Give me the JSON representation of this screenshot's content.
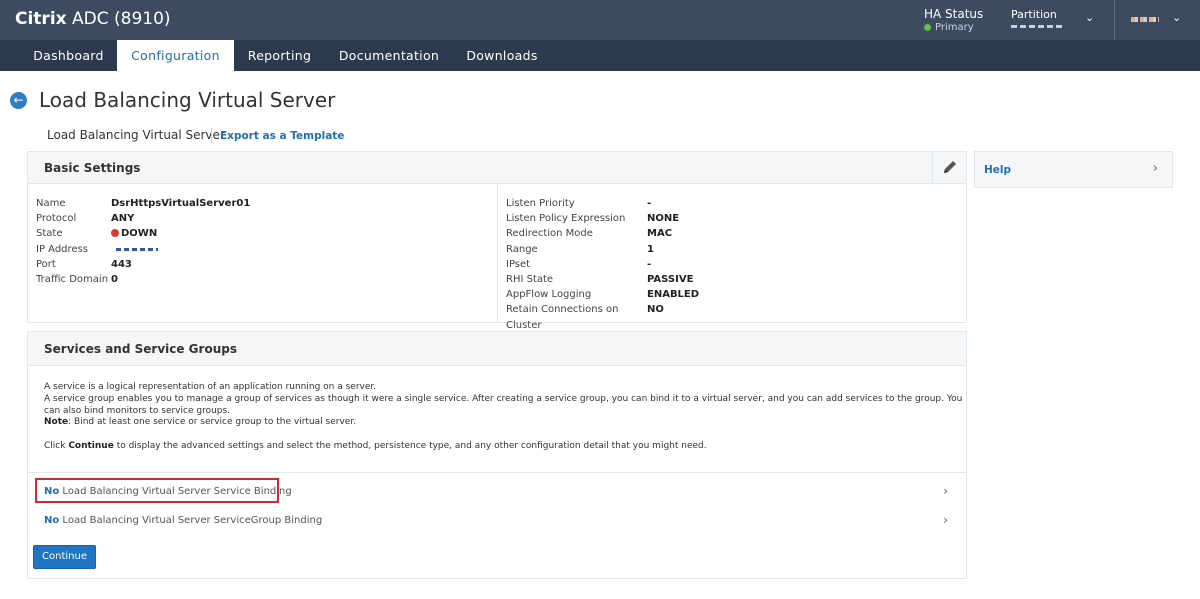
{
  "header": {
    "brand_bold": "Citrix",
    "brand_rest": " ADC (8910)",
    "ha_label": "HA Status",
    "ha_value": "Primary",
    "ha_status_color": "#6abf4b",
    "partition_label": "Partition"
  },
  "nav": {
    "tabs": [
      {
        "label": "Dashboard",
        "active": false
      },
      {
        "label": "Configuration",
        "active": true
      },
      {
        "label": "Reporting",
        "active": false
      },
      {
        "label": "Documentation",
        "active": false
      },
      {
        "label": "Downloads",
        "active": false
      }
    ]
  },
  "page": {
    "title": "Load Balancing Virtual Server",
    "breadcrumb_current": "Load Balancing Virtual Server",
    "export_link": "Export as a Template"
  },
  "basic_settings": {
    "title": "Basic Settings",
    "left": {
      "name_label": "Name",
      "name_value": "DsrHttpsVirtualServer01",
      "protocol_label": "Protocol",
      "protocol_value": "ANY",
      "state_label": "State",
      "state_value": "DOWN",
      "state_color": "#d83b2f",
      "ip_label": "IP Address",
      "port_label": "Port",
      "port_value": "443",
      "traffic_label": "Traffic Domain",
      "traffic_value": "0"
    },
    "right": {
      "listen_priority_label": "Listen Priority",
      "listen_priority_value": "-",
      "listen_policy_label": "Listen Policy Expression",
      "listen_policy_value": "NONE",
      "redirection_label": "Redirection Mode",
      "redirection_value": "MAC",
      "range_label": "Range",
      "range_value": "1",
      "ipset_label": "IPset",
      "ipset_value": "-",
      "rhi_label": "RHI State",
      "rhi_value": "PASSIVE",
      "appflow_label": "AppFlow Logging",
      "appflow_value": "ENABLED",
      "retain_label": "Retain Connections on Cluster",
      "retain_value": "NO"
    }
  },
  "services": {
    "title": "Services and Service Groups",
    "desc_line1": "A service is a logical representation of an application running on a server.",
    "desc_line2": "A service group enables you to manage a group of services as though it were a single service. After creating a service group, you can bind it to a virtual server, and you can add services to the group. You can also bind monitors to service groups.",
    "note_bold": "Note",
    "note_rest": ": Bind at least one service or service group to the virtual server.",
    "click_pre": "Click ",
    "click_bold": "Continue",
    "click_post": " to display the advanced settings and select the method, persistence type, and any other configuration detail that you might need.",
    "binding1_bold": "No",
    "binding1_rest": " Load Balancing Virtual Server Service Binding",
    "binding2_bold": "No",
    "binding2_rest": " Load Balancing Virtual Server ServiceGroup Binding",
    "continue_label": "Continue"
  },
  "help": {
    "label": "Help"
  }
}
